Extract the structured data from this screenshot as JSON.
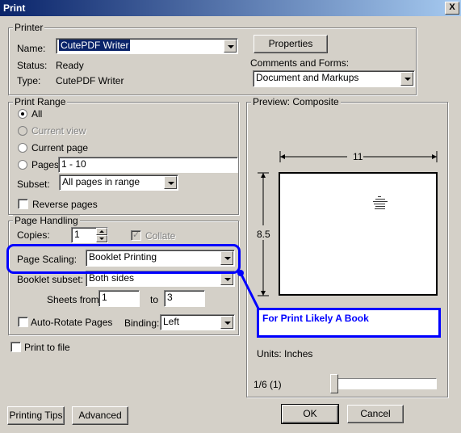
{
  "window": {
    "title": "Print",
    "close_label": "X"
  },
  "printer": {
    "legend": "Printer",
    "name_label": "Name:",
    "name_value": "CutePDF Writer",
    "status_label": "Status:",
    "status_value": "Ready",
    "type_label": "Type:",
    "type_value": "CutePDF Writer",
    "properties_label": "Properties",
    "comments_label": "Comments and Forms:",
    "comments_value": "Document and Markups"
  },
  "print_range": {
    "legend": "Print Range",
    "all_label": "All",
    "current_view_label": "Current view",
    "current_page_label": "Current page",
    "pages_label": "Pages",
    "pages_value": "1 - 10",
    "subset_label": "Subset:",
    "subset_value": "All pages in range",
    "reverse_label": "Reverse pages"
  },
  "page_handling": {
    "legend": "Page Handling",
    "copies_label": "Copies:",
    "copies_value": "1",
    "collate_label": "Collate",
    "scaling_label": "Page Scaling:",
    "scaling_value": "Booklet Printing",
    "booklet_subset_label": "Booklet subset:",
    "booklet_subset_value": "Both sides",
    "sheets_from_label": "Sheets from",
    "sheets_from_value": "1",
    "sheets_to_label": "to",
    "sheets_to_value": "3",
    "autorotate_label": "Auto-Rotate Pages",
    "binding_label": "Binding:",
    "binding_value": "Left"
  },
  "print_to_file_label": "Print to file",
  "preview": {
    "legend": "Preview: Composite",
    "width_label": "11",
    "height_label": "8.5",
    "units_label": "Units: Inches",
    "page_counter": "1/6 (1)"
  },
  "annotation": {
    "text": "For Print Likely A Book",
    "color": "#0000ff"
  },
  "buttons": {
    "tips_label": "Printing Tips",
    "advanced_label": "Advanced",
    "ok_label": "OK",
    "cancel_label": "Cancel"
  }
}
